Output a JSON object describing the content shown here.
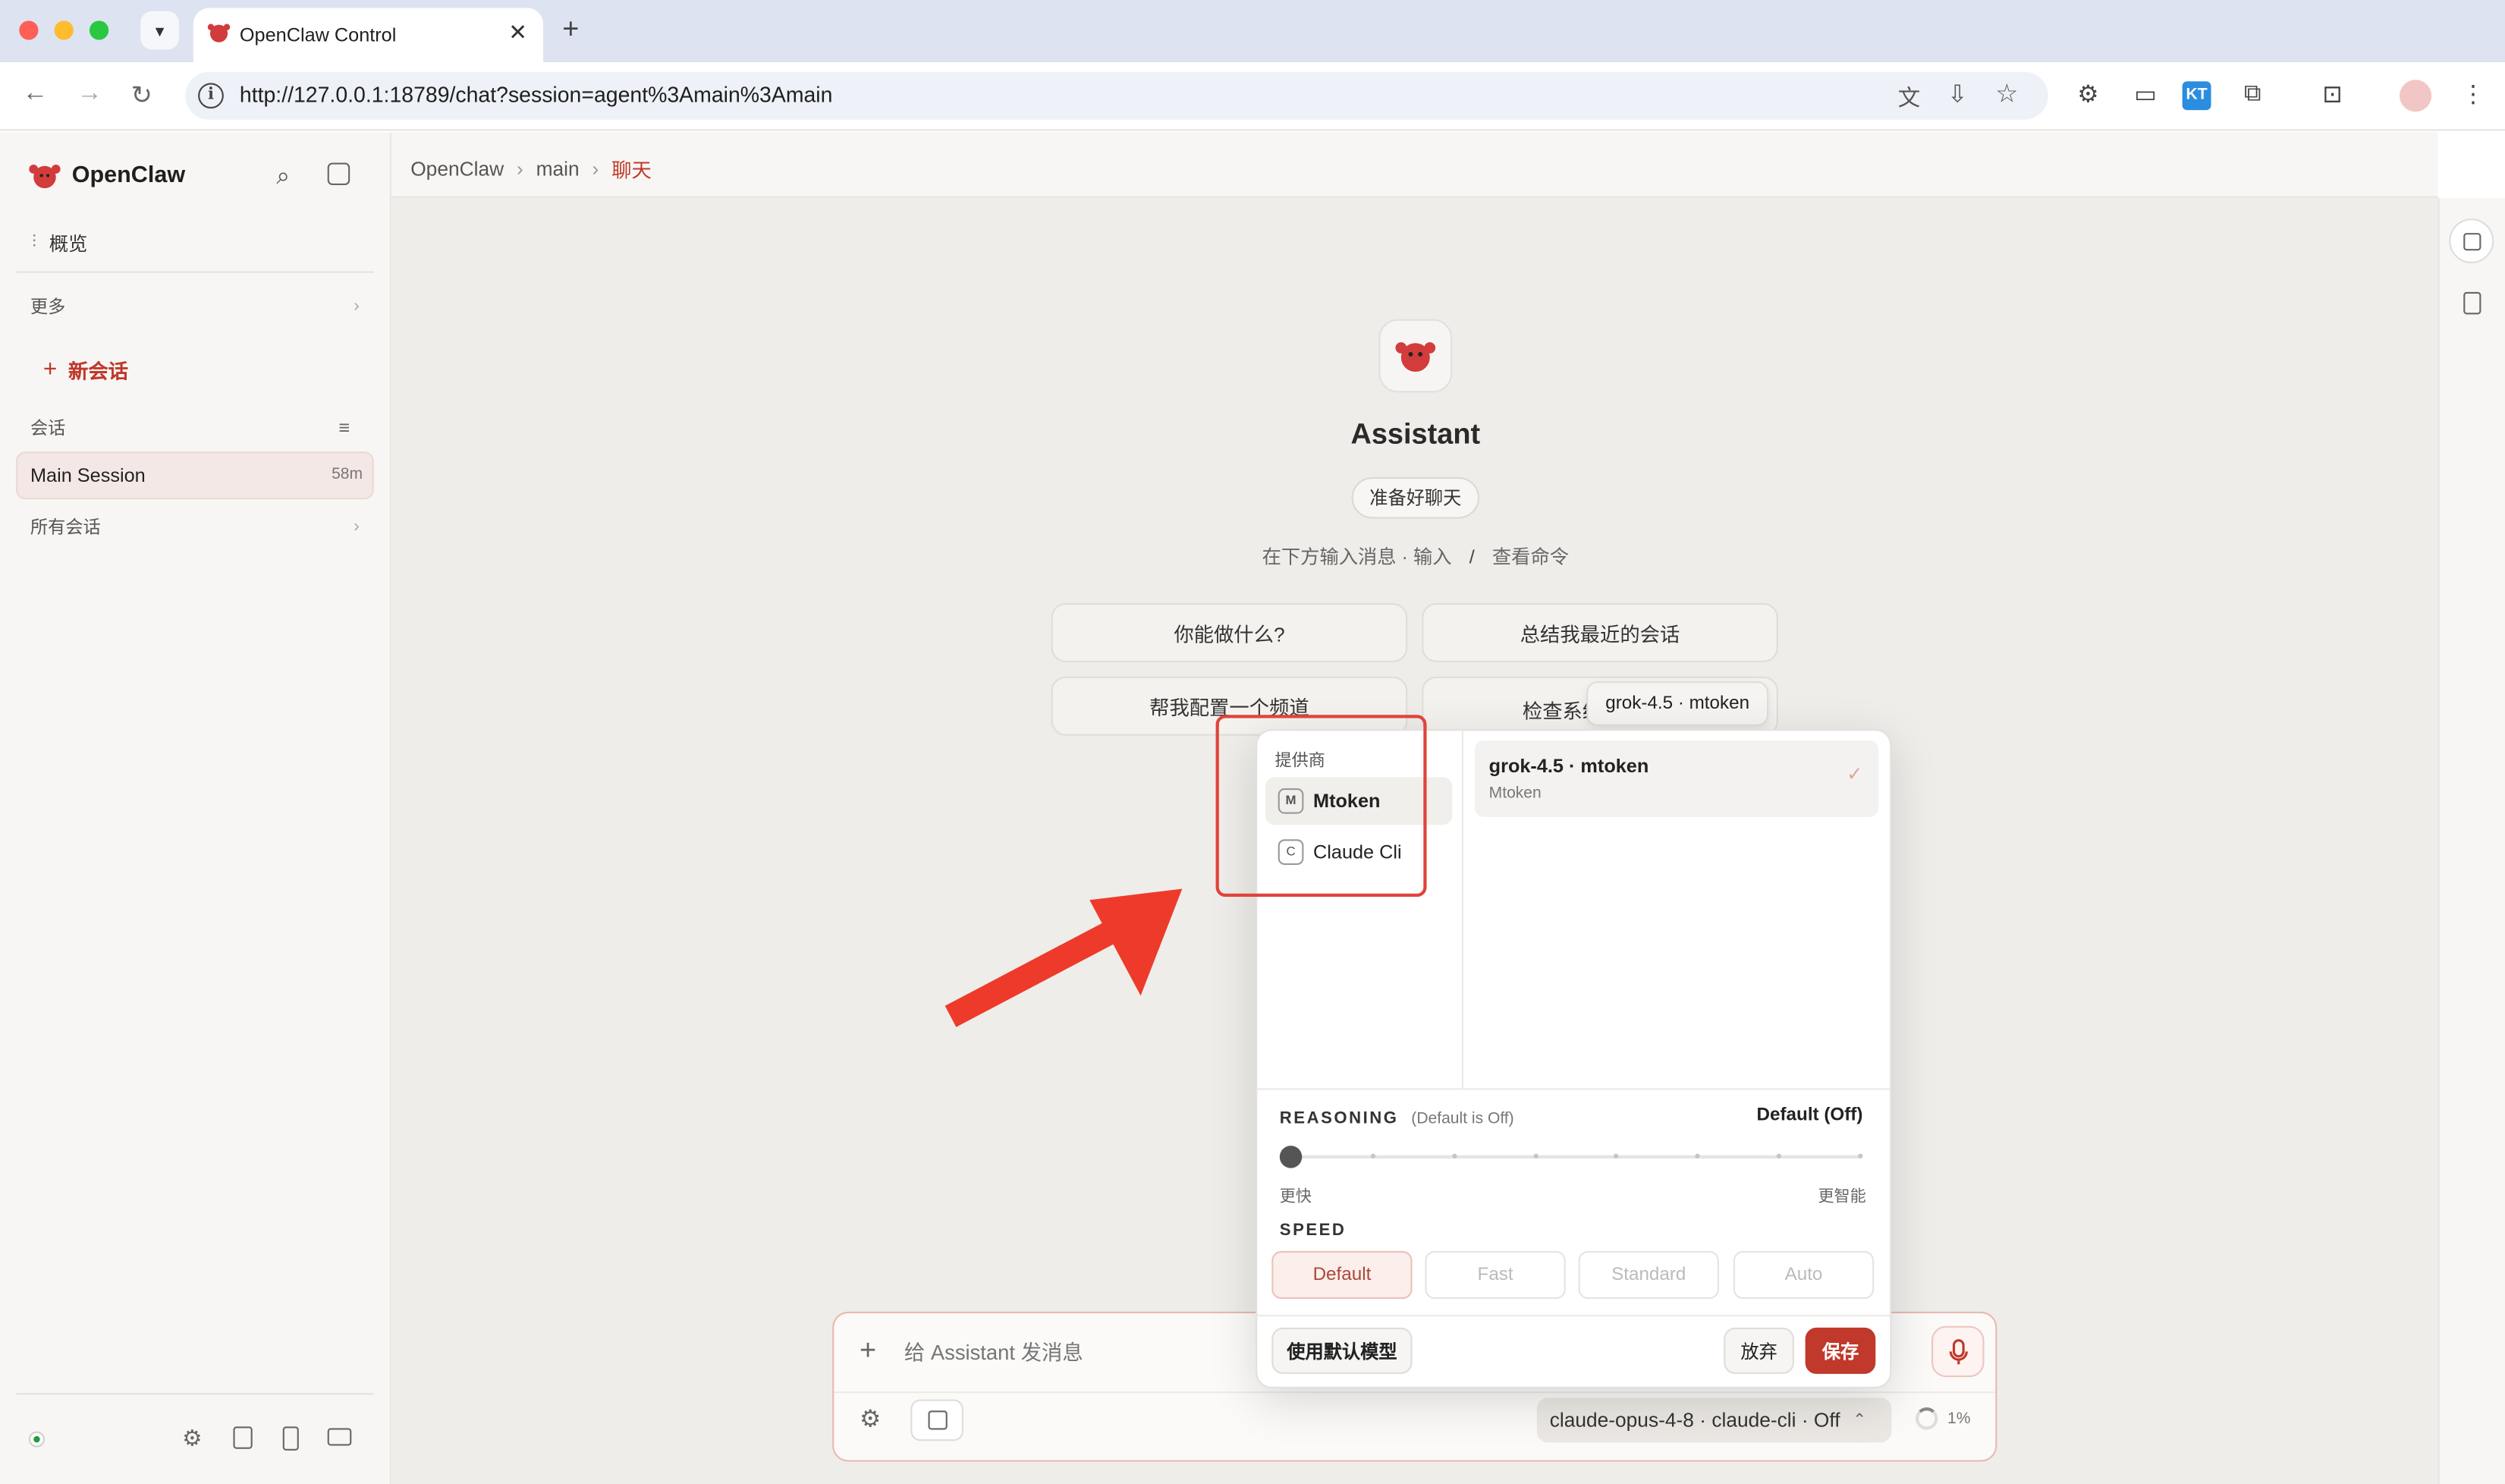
{
  "browser": {
    "tab_title": "OpenClaw Control",
    "url": "http://127.0.0.1:18789/chat?session=agent%3Amain%3Amain"
  },
  "sidebar": {
    "brand": "OpenClaw",
    "overview": "概览",
    "more": "更多",
    "new_chat": "新会话",
    "sessions_header": "会话",
    "main_session": "Main Session",
    "main_session_age": "58m",
    "all_sessions": "所有会话"
  },
  "breadcrumb": {
    "root": "OpenClaw",
    "mid": "main",
    "current": "聊天"
  },
  "assistant": {
    "name": "Assistant",
    "status": "准备好聊天",
    "hint_prefix": "在下方输入消息 · 输入",
    "hint_key": "/",
    "hint_suffix": "查看命令"
  },
  "suggestions": [
    "你能做什么?",
    "总结我最近的会话",
    "帮我配置一个频道",
    "检查系统"
  ],
  "tooltip": "grok-4.5 · mtoken",
  "model_picker": {
    "providers_label": "提供商",
    "providers": [
      {
        "badge": "M",
        "name": "Mtoken"
      },
      {
        "badge": "C",
        "name": "Claude Cli"
      }
    ],
    "selected_model": "grok-4.5 · mtoken",
    "selected_model_provider": "Mtoken",
    "reasoning_label": "REASONING",
    "reasoning_default_note": "(Default is Off)",
    "reasoning_value": "Default (Off)",
    "reasoning_level": 0,
    "reasoning_steps": 8,
    "slider_min_label": "更快",
    "slider_max_label": "更智能",
    "speed_label": "SPEED",
    "speed_options": [
      "Default",
      "Fast",
      "Standard",
      "Auto"
    ],
    "use_default_model": "使用默认模型",
    "discard": "放弃",
    "save": "保存"
  },
  "composer": {
    "placeholder": "给 Assistant 发消息",
    "model_chip": "claude-opus-4-8 · claude-cli · Off",
    "context_usage": "1%"
  },
  "colors": {
    "accent": "#c0392b",
    "annotation": "#e0443a",
    "status_online": "#1e9e3a"
  }
}
